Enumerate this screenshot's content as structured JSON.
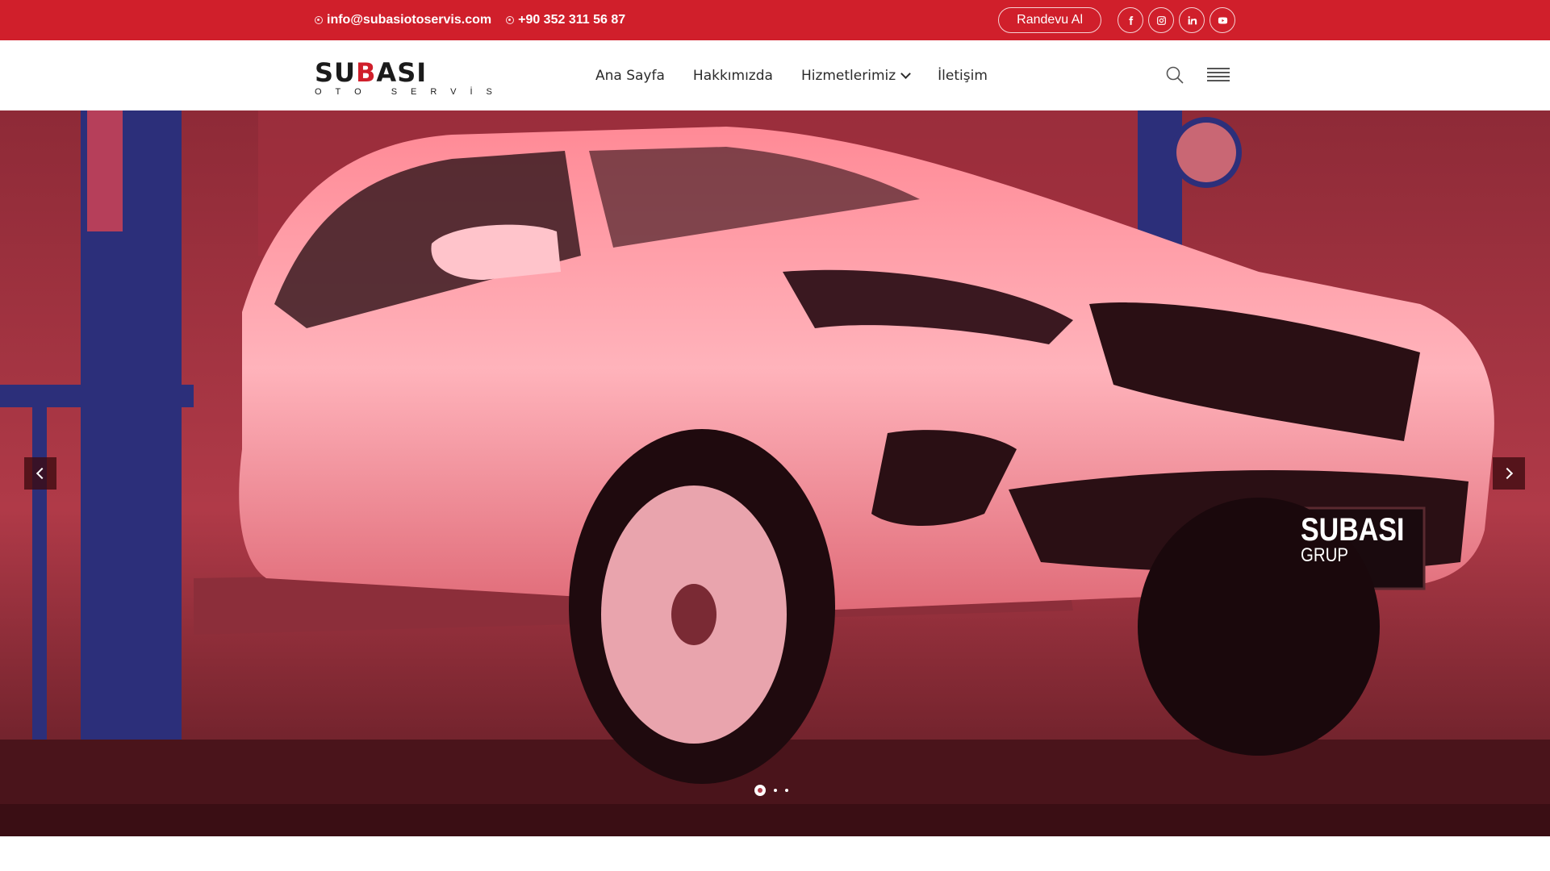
{
  "topbar": {
    "email": "info@subasiotoservis.com",
    "phone": "+90 352 311 56 87",
    "appointment_label": "Randevu Al",
    "socials": [
      "facebook-icon",
      "instagram-icon",
      "linkedin-icon",
      "youtube-icon"
    ],
    "background_color": "#d01f2b"
  },
  "logo": {
    "word_left": "SU",
    "word_accent": "B",
    "word_right": "ASI",
    "tagline": "OTO SERVİS"
  },
  "nav": {
    "items": [
      {
        "label": "Ana Sayfa"
      },
      {
        "label": "Hakkımızda"
      },
      {
        "label": "Hizmetlerimiz",
        "has_dropdown": true
      },
      {
        "label": "İletişim"
      }
    ]
  },
  "hero": {
    "plate_brand": "SUBASI",
    "plate_sub": "GRUP",
    "slides_total": 3,
    "active_slide": 1
  },
  "colors": {
    "accent": "#d01f2b",
    "hero_tint": "#c23a4c"
  }
}
